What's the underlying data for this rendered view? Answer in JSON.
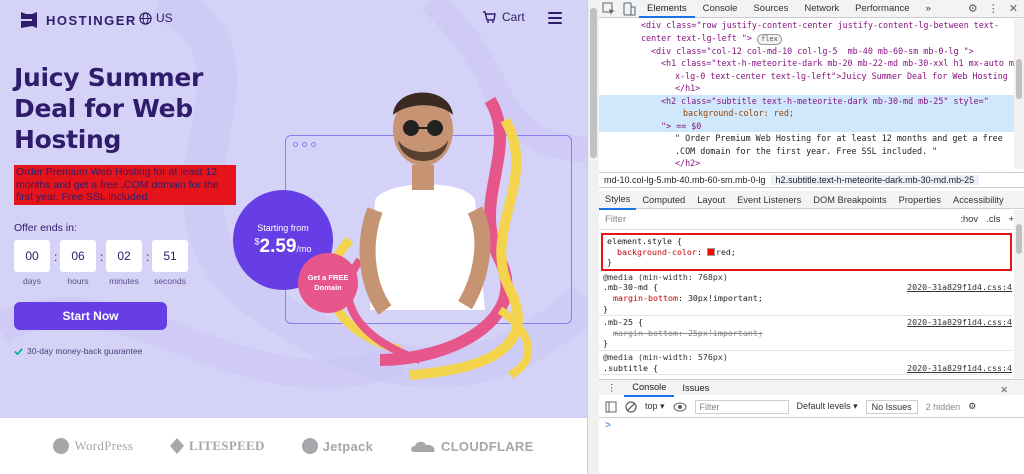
{
  "site": {
    "logo": "HOSTINGER",
    "lang": "US",
    "cart": "Cart",
    "headline": "Juicy Summer Deal for Web Hosting",
    "subtitle": "Order Premium Web Hosting for at least 12 months and get a free .COM domain for the first year. Free SSL included.",
    "offer_label": "Offer ends in:",
    "timer": [
      {
        "value": "00",
        "label": "days"
      },
      {
        "value": "06",
        "label": "hours"
      },
      {
        "value": "02",
        "label": "minutes"
      },
      {
        "value": "51",
        "label": "seconds"
      }
    ],
    "cta": "Start Now",
    "guarantee": "30-day money-back guarantee",
    "price_from": "Starting from",
    "price_currency": "$",
    "price_amount": "2.59",
    "price_per": "/mo",
    "free_badge": "Get a FREE Domain",
    "partners": [
      "WordPress",
      "LITESPEED",
      "Jetpack",
      "CLOUDFLARE"
    ],
    "colors": {
      "brand": "#673de6",
      "hero_bg": "#d5d2f8",
      "highlight": "#e5141a",
      "badge": "#e7568a"
    }
  },
  "devtools": {
    "tabs": [
      "Elements",
      "Console",
      "Sources",
      "Network",
      "Performance"
    ],
    "more": "»",
    "dom_lines": [
      "<div class=\"row justify-content-center justify-content-lg-between text-",
      "center text-lg-left \">",
      "<div class=\"col-12 col-md-10 col-lg-5  mb-40 mb-60-sm mb-0-lg \">",
      "<h1 class=\"text-h-meteorite-dark mb-20 mb-22-md mb-30-xxl h1 mx-auto m",
      "x-lg-0 text-center text-lg-left\">Juicy Summer Deal for Web Hosting",
      "</h1>",
      "<h2 class=\"subtitle text-h-meteorite-dark mb-30-md mb-25\" style=\"",
      "background-color: red;",
      "\"> == $0",
      "\" Order Premium Web Hosting for at least 12 months and get a free",
      ".COM domain for the first year. Free SSL included. \"",
      "</h2>"
    ],
    "flex_badge": "flex",
    "breadcrumbs": [
      "md-10.col-lg-5.mb-40.mb-60-sm.mb-0-lg",
      "h2.subtitle.text-h-meteorite-dark.mb-30-md.mb-25"
    ],
    "style_tabs": [
      "Styles",
      "Computed",
      "Layout",
      "Event Listeners",
      "DOM Breakpoints",
      "Properties",
      "Accessibility"
    ],
    "filter_placeholder": "Filter",
    "filter_tools": [
      ":hov",
      ".cls",
      "+"
    ],
    "rules": {
      "element_selector": "element.style {",
      "element_prop": "background-color",
      "element_val": "red;",
      "media1": "@media (min-width: 768px)",
      "sel1": ".mb-30-md {",
      "prop1": "margin-bottom",
      "val1": "30px!important;",
      "src1": "2020-31a829f1d4.css:4",
      "sel2": ".mb-25 {",
      "prop2": "margin-bottom",
      "val2": "25px!important;",
      "src2": "2020-31a829f1d4.css:4",
      "media3": "@media (min-width: 576px)",
      "sel3": ".subtitle {",
      "src3": "2020-31a829f1d4.css:4",
      "close": "}"
    },
    "drawer_tabs": [
      "Console",
      "Issues"
    ],
    "console_context": "top",
    "console_filter": "Filter",
    "levels": "Default levels",
    "no_issues": "No Issues",
    "hidden": "2 hidden",
    "prompt": ">"
  }
}
